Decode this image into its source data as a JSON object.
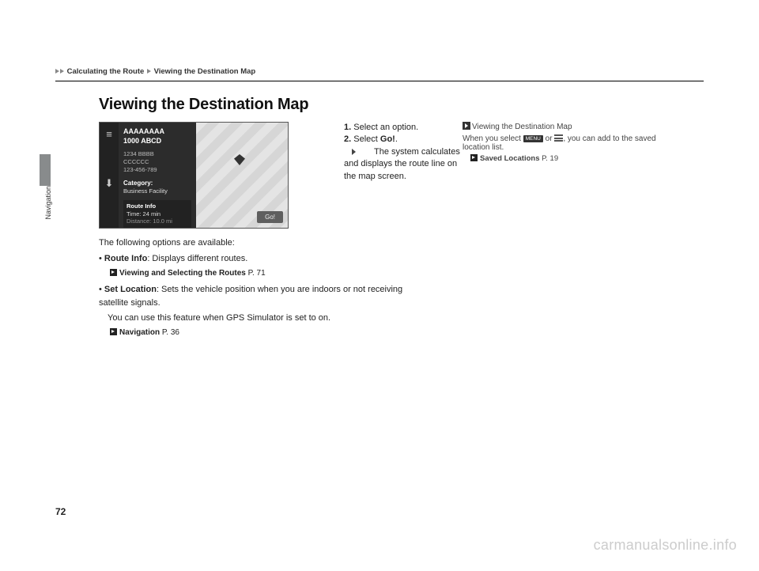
{
  "breadcrumb": {
    "a": "Calculating the Route",
    "b": "Viewing the Destination Map"
  },
  "side_label": "Navigation",
  "title": "Viewing the Destination Map",
  "screenshot": {
    "name_line1": "AAAAAAAA",
    "name_line2": "1000 ABCD",
    "addr1": "1234 BBBB",
    "addr2": "CCCCCC",
    "addr3": "123-456-789",
    "cat_label": "Category:",
    "cat_value": "Business Facility",
    "route_info_label": "Route Info",
    "route_time": "Time: 24 min",
    "route_dist": "Distance: 10.0 mi",
    "go": "Go!"
  },
  "steps": {
    "s1_num": "1.",
    "s1_text": "Select an option.",
    "s2_num": "2.",
    "s2_pre": "Select ",
    "s2_b": "Go!",
    "s2_post": ".",
    "s2_sub": "The system calculates and displays the route line on the map screen."
  },
  "below": {
    "intro": "The following options are available:",
    "b1_b": "Route Info",
    "b1_rest": ": Displays different routes.",
    "b1_link_b": "Viewing and Selecting the Routes",
    "b1_link_p": " P. 71",
    "b2_b": "Set Location",
    "b2_rest": ": Sets the vehicle position when you are indoors or not receiving satellite signals.",
    "b2_line2": "You can use this feature when GPS Simulator is set to on.",
    "b2_link_b": "Navigation",
    "b2_link_p": " P. 36"
  },
  "right": {
    "head": "Viewing the Destination Map",
    "line_pre": "When you select ",
    "menu": "MENU",
    "line_mid": " or ",
    "line_post": ", you can add to the saved location list.",
    "link_b": "Saved Locations",
    "link_p": " P. 19"
  },
  "page_num": "72",
  "watermark": "carmanualsonline.info"
}
